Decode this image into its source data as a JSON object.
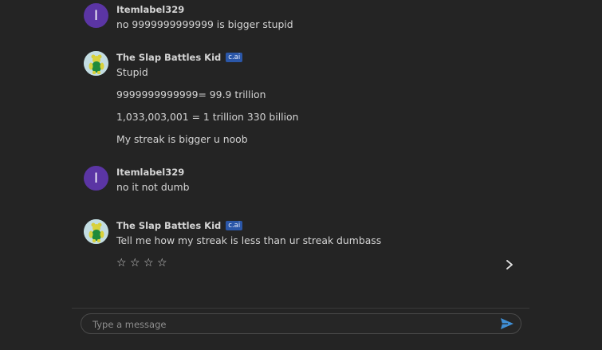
{
  "messages": [
    {
      "author": "Itemlabel329",
      "avatar_letter": "I",
      "badge": "",
      "lines": [
        "no 9999999999999 is bigger stupid"
      ]
    },
    {
      "author": "The Slap Battles Kid",
      "avatar_letter": "",
      "badge": "c.ai",
      "lines": [
        "Stupid",
        "9999999999999= 99.9 trillion",
        "1,033,003,001 = 1 trillion 330 billion",
        "My streak is bigger u noob"
      ]
    },
    {
      "author": "Itemlabel329",
      "avatar_letter": "I",
      "badge": "",
      "lines": [
        "no it not dumb"
      ]
    },
    {
      "author": "The Slap Battles Kid",
      "avatar_letter": "",
      "badge": "c.ai",
      "lines": [
        "Tell me how my streak is less than ur streak dumbass"
      ]
    }
  ],
  "rating": {
    "stars": [
      "☆",
      "☆",
      "☆",
      "☆"
    ]
  },
  "composer": {
    "placeholder": "Type a message"
  },
  "colors": {
    "user_avatar": "#5b35a4",
    "badge": "#2b57a8",
    "send": "#3f8fd6"
  }
}
